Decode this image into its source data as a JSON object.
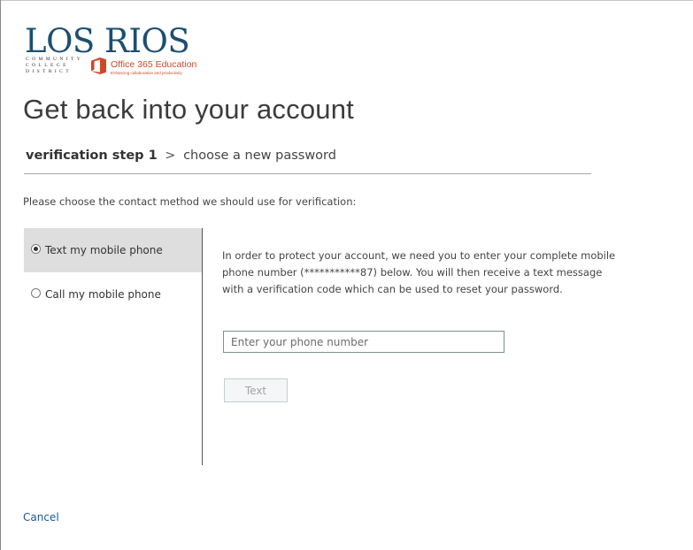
{
  "brand": {
    "wordmark": "LOS RIOS",
    "sub_lines": [
      "Community",
      "College",
      "District"
    ],
    "product_title": "Office 365 Education",
    "product_tagline": "Enhancing collaboration and productivity",
    "product_icon": "office-logo-icon",
    "colors": {
      "wordmark": "#1b4f72",
      "office": "#d04727"
    }
  },
  "page": {
    "title": "Get back into your account"
  },
  "breadcrumb": {
    "current": "verification step 1",
    "separator": ">",
    "next": "choose a new password"
  },
  "instruction": "Please choose the contact method we should use for verification:",
  "methods": [
    {
      "label": "Text my mobile phone",
      "selected": true
    },
    {
      "label": "Call my mobile phone",
      "selected": false
    }
  ],
  "details": {
    "text": "In order to protect your account, we need you to enter your complete mobile phone number (***********87) below. You will then receive a text message with a verification code which can be used to reset your password."
  },
  "phone_input": {
    "value": "",
    "placeholder": "Enter your phone number"
  },
  "action_button": {
    "label": "Text",
    "enabled": false
  },
  "cancel_link": "Cancel",
  "colors": {
    "link": "#1a5a9a",
    "selected_bg": "#dedede"
  }
}
